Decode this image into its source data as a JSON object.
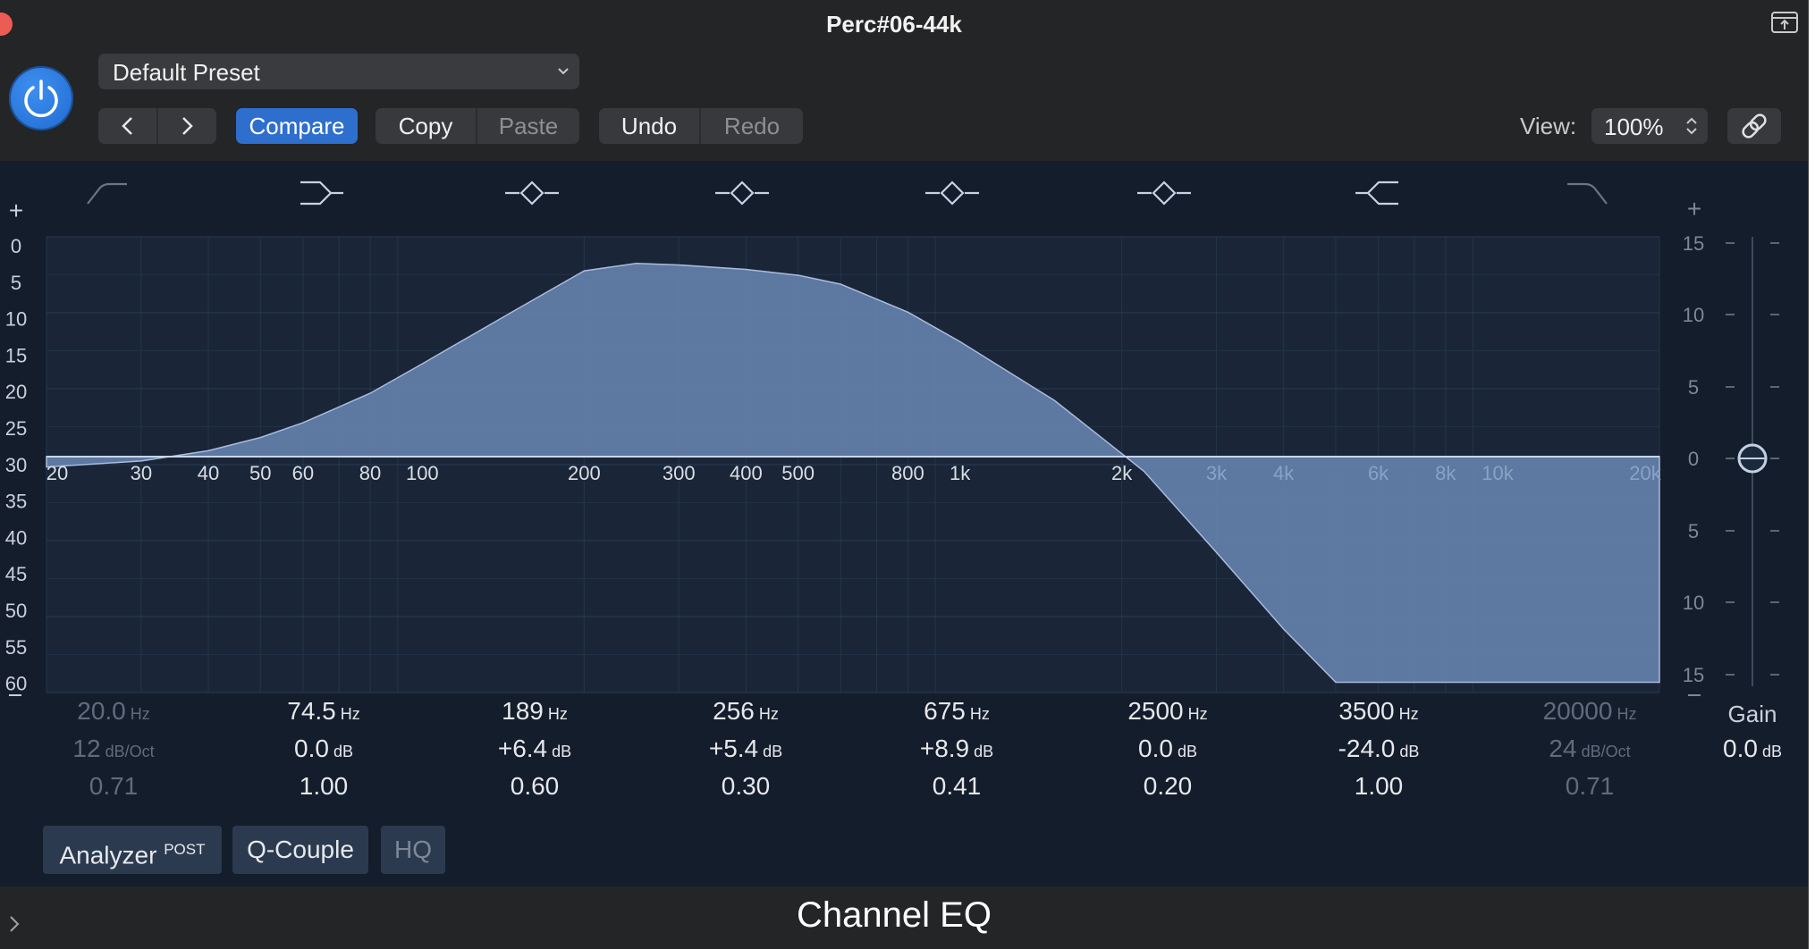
{
  "window": {
    "title": "Perc#06-44k"
  },
  "toolbar": {
    "preset": "Default Preset",
    "compare_label": "Compare",
    "copy_label": "Copy",
    "paste_label": "Paste",
    "undo_label": "Undo",
    "redo_label": "Redo",
    "view_label": "View:",
    "view_value": "100%"
  },
  "graph": {
    "plus_left": "+",
    "plus_right": "+",
    "left_db_labels": [
      "0",
      "5",
      "10",
      "15",
      "20",
      "25",
      "30",
      "35",
      "40",
      "45",
      "50",
      "55",
      "60"
    ],
    "right_db_labels": [
      "15",
      "10",
      "5",
      "0",
      "5",
      "10",
      "15"
    ],
    "freq_labels": [
      "20",
      "30",
      "40",
      "50",
      "60",
      "80",
      "100",
      "200",
      "300",
      "400",
      "500",
      "800",
      "1k",
      "2k",
      "3k",
      "4k",
      "6k",
      "8k",
      "10k",
      "20k"
    ],
    "band_types": [
      "low-cut",
      "low-shelf",
      "bell",
      "bell",
      "bell",
      "bell",
      "high-shelf",
      "high-cut"
    ]
  },
  "bands": [
    {
      "freq": "20.0",
      "freq_unit": "Hz",
      "gain": "12",
      "gain_unit": "dB/Oct",
      "q": "0.71",
      "enabled": false
    },
    {
      "freq": "74.5",
      "freq_unit": "Hz",
      "gain": "0.0",
      "gain_unit": "dB",
      "q": "1.00",
      "enabled": true
    },
    {
      "freq": "189",
      "freq_unit": "Hz",
      "gain": "+6.4",
      "gain_unit": "dB",
      "q": "0.60",
      "enabled": true
    },
    {
      "freq": "256",
      "freq_unit": "Hz",
      "gain": "+5.4",
      "gain_unit": "dB",
      "q": "0.30",
      "enabled": true
    },
    {
      "freq": "675",
      "freq_unit": "Hz",
      "gain": "+8.9",
      "gain_unit": "dB",
      "q": "0.41",
      "enabled": true
    },
    {
      "freq": "2500",
      "freq_unit": "Hz",
      "gain": "0.0",
      "gain_unit": "dB",
      "q": "0.20",
      "enabled": true
    },
    {
      "freq": "3500",
      "freq_unit": "Hz",
      "gain": "-24.0",
      "gain_unit": "dB",
      "q": "1.00",
      "enabled": true
    },
    {
      "freq": "20000",
      "freq_unit": "Hz",
      "gain": "24",
      "gain_unit": "dB/Oct",
      "q": "0.71",
      "enabled": false
    }
  ],
  "gain": {
    "label": "Gain",
    "value": "0.0",
    "unit": "dB"
  },
  "bottom_buttons": {
    "analyzer": "Analyzer",
    "analyzer_mode": "POST",
    "q_couple": "Q-Couple",
    "hq": "HQ"
  },
  "footer": {
    "title": "Channel EQ"
  },
  "colors": {
    "accent": "#2e6fce",
    "curve_fill": "#6a87b4",
    "display_bg": "#141d2b"
  }
}
